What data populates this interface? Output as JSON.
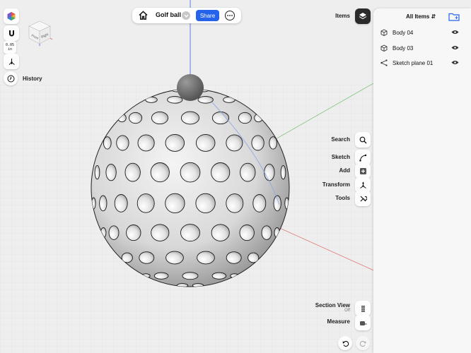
{
  "toolbar": {
    "home_icon": "home-icon",
    "document_title": "Golf ball",
    "share_label": "Share",
    "more_icon": "ellipsis-icon"
  },
  "left_tools": {
    "units_value": "0.05",
    "units_unit": "in",
    "history_label": "History"
  },
  "view_cube": {
    "front": "Front",
    "right": "Right"
  },
  "right_tools": {
    "items_label": "Items",
    "search_label": "Search",
    "sketch_label": "Sketch",
    "add_label": "Add",
    "transform_label": "Transform",
    "tools_label": "Tools",
    "section_view_label": "Section View",
    "section_view_state": "Off",
    "measure_label": "Measure"
  },
  "items_panel": {
    "title": "All Items",
    "items": [
      {
        "label": "Body 04",
        "icon": "cube-icon"
      },
      {
        "label": "Body 03",
        "icon": "cube-icon"
      },
      {
        "label": "Sketch plane 01",
        "icon": "sketch-plane-icon"
      }
    ]
  },
  "colors": {
    "accent": "#2563eb",
    "axis_x": "#e06666",
    "axis_y": "#66bb66",
    "axis_z": "#3b63e6",
    "background": "#eeeeee"
  }
}
